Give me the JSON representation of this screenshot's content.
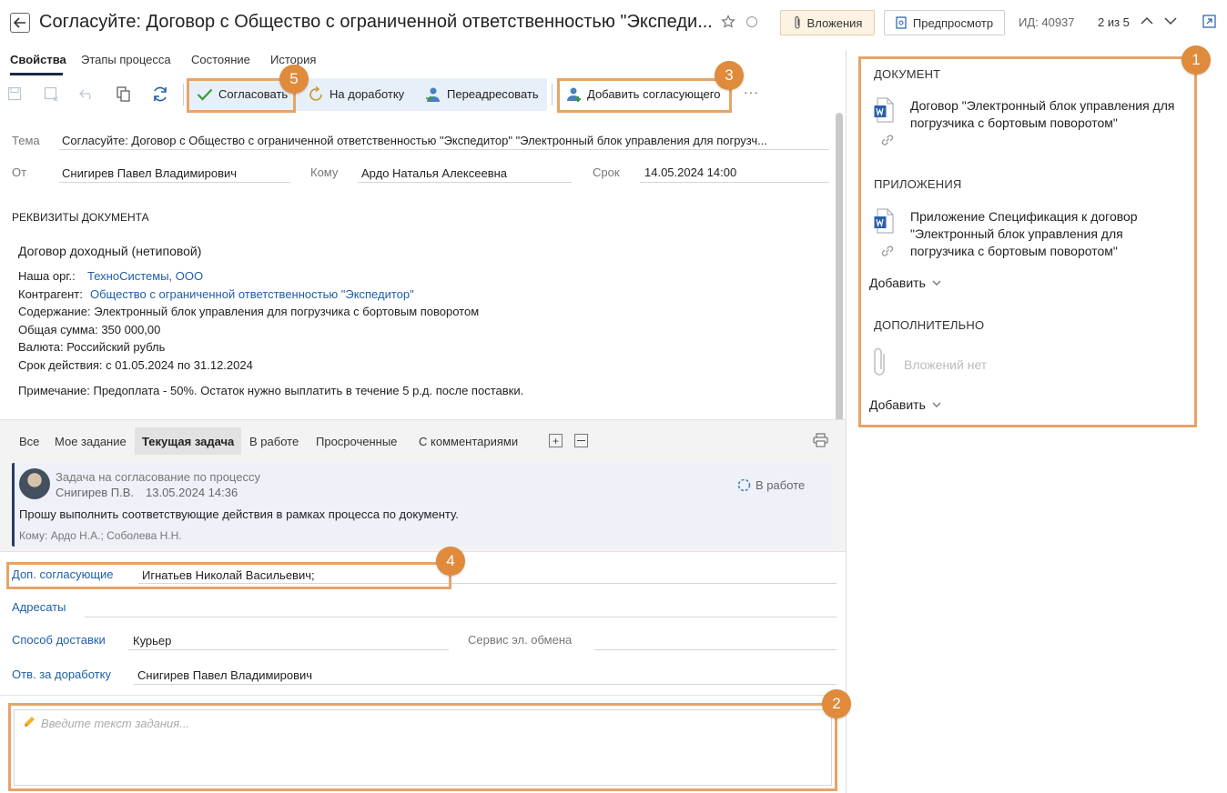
{
  "header": {
    "title": "Согласуйте: Договор с Общество с ограниченной ответственностью \"Экспеди...",
    "attachments_label": "Вложения",
    "preview_label": "Предпросмотр",
    "id_label": "ИД: 40937",
    "pager": "2 из 5"
  },
  "tabs": [
    "Свойства",
    "Этапы процесса",
    "Состояние",
    "История"
  ],
  "toolbar": {
    "approve_label": "Согласовать",
    "rework_label": "На доработку",
    "redirect_label": "Переадресовать",
    "add_approver_label": "Добавить согласующего",
    "more_label": "···"
  },
  "form": {
    "subject_label": "Тема",
    "subject_value": "Согласуйте: Договор с Общество с ограниченной ответственностью \"Экспедитор\" \"Электронный блок управления для погрузч...",
    "from_label": "От",
    "from_value": "Снигирев Павел Владимирович",
    "to_label": "Кому",
    "to_value": "Ардо Наталья Алексеевна",
    "due_label": "Срок",
    "due_value": "14.05.2024 14:00"
  },
  "requisites": {
    "heading": "РЕКВИЗИТЫ ДОКУМЕНТА",
    "doc_type": "Договор доходный (нетиповой)",
    "org_label": "Наша орг.:",
    "org_value": "ТехноСистемы, ООО",
    "counterparty_label": "Контрагент:",
    "counterparty_value": "Общество с ограниченной ответственностью \"Экспедитор\"",
    "content": "Содержание: Электронный блок управления для погрузчика с бортовым поворотом",
    "total": "Общая сумма: 350 000,00",
    "currency": "Валюта: Российский рубль",
    "validity": "Срок действия: с 01.05.2024 по 31.12.2024",
    "note": "Примечание: Предоплата - 50%. Остаток нужно выплатить в течение 5 р.д. после поставки."
  },
  "feed_tabs": [
    "Все",
    "Мое задание",
    "Текущая задача",
    "В работе",
    "Просроченные",
    "С комментариями"
  ],
  "task_card": {
    "title": "Задача на согласование по процессу",
    "author": "Снигирев П.В.",
    "date": "13.05.2024 14:36",
    "status": "В работе",
    "message": "Прошу выполнить соответствующие действия в рамках процесса по документу.",
    "recipients": "Кому: Ардо Н.А.; Соболева Н.Н."
  },
  "extra_fields": {
    "add_approvers_label": "Доп. согласующие",
    "add_approvers_value": "Игнатьев Николай Васильевич;",
    "addressees_label": "Адресаты",
    "delivery_label": "Способ доставки",
    "delivery_value": "Курьер",
    "exchange_label": "Сервис эл. обмена",
    "rework_resp_label": "Отв. за доработку",
    "rework_resp_value": "Снигирев Павел Владимирович"
  },
  "comment": {
    "placeholder": "Введите текст задания..."
  },
  "right_panel": {
    "doc_heading": "ДОКУМЕНТ",
    "doc_line1": "Договор \"Электронный блок управления для",
    "doc_line2": "погрузчика с бортовым поворотом\"",
    "app_heading": "ПРИЛОЖЕНИЯ",
    "app_line1": "Приложение Спецификация к договор",
    "app_line2": "\"Электронный блок управления для",
    "app_line3": "погрузчика с бортовым поворотом\"",
    "add_label": "Добавить",
    "extra_heading": "ДОПОЛНИТЕЛЬНО",
    "no_attachments": "Вложений нет",
    "add_label2": "Добавить"
  },
  "badges": [
    "1",
    "2",
    "3",
    "4",
    "5"
  ],
  "colors": {
    "accent_orange": "#e08a3c",
    "highlight_border": "#e6a468",
    "link_blue": "#1f5fa8",
    "approve_green": "#3a9a3a",
    "toolbar_bg": "#e7f0f9"
  }
}
